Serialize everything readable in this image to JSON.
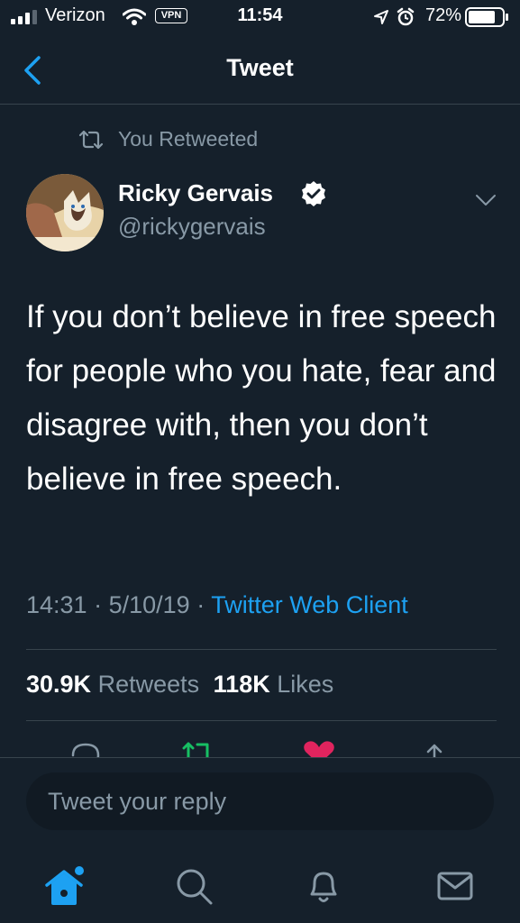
{
  "status_bar": {
    "carrier": "Verizon",
    "vpn": "VPN",
    "time": "11:54",
    "battery": "72%"
  },
  "nav": {
    "title": "Tweet",
    "back_icon": "chevron-left-icon"
  },
  "retweet_context": {
    "label": "You Retweeted",
    "icon": "retweet-icon"
  },
  "tweet": {
    "author_name": "Ricky Gervais",
    "handle": "@rickygervais",
    "verified": true,
    "text": "If you don’t believe in free speech for people who you hate, fear and disagree with, then you don’t believe in free speech.",
    "time": "14:31",
    "date": "5/10/19",
    "separator": "·",
    "client": "Twitter Web Client"
  },
  "stats": {
    "retweets_count": "30.9K",
    "retweets_label": "Retweets",
    "likes_count": "118K",
    "likes_label": "Likes"
  },
  "actions": {
    "icons": [
      "reply-icon",
      "retweet-icon",
      "like-icon",
      "share-icon"
    ],
    "retweet_color": "#17bf63",
    "like_color": "#e0245e"
  },
  "reply": {
    "placeholder": "Tweet your reply"
  },
  "tabbar": {
    "tabs": [
      "home-icon",
      "search-icon",
      "notifications-icon",
      "messages-icon"
    ],
    "active_color": "#1da1f2",
    "inactive_color": "#8899a6"
  },
  "colors": {
    "background": "#15202b",
    "secondary_text": "#8899a6",
    "accent": "#1da1f2",
    "divider": "#38444d"
  }
}
